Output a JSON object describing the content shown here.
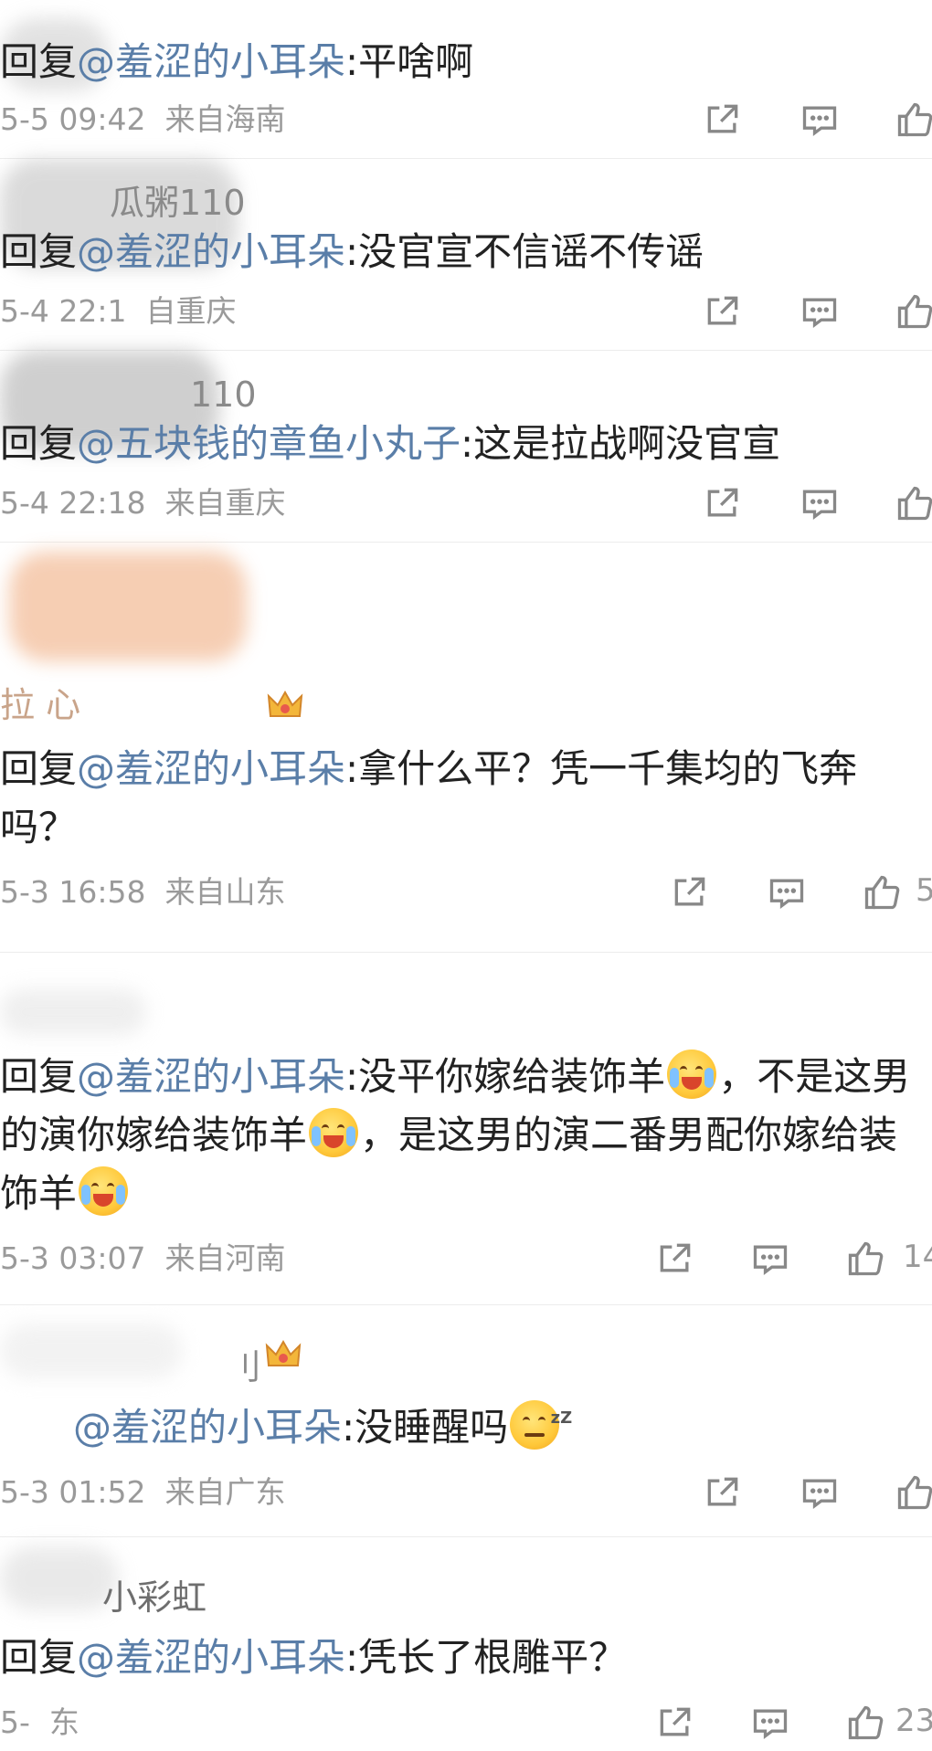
{
  "comments": [
    {
      "username": "",
      "reply_prefix": "回复",
      "mention": "@羞涩的小耳朵",
      "text": ":平啥啊",
      "time": "5-5 09:42",
      "location": "来自海南",
      "likes": ""
    },
    {
      "username": "瓜粥110",
      "reply_prefix": "回复",
      "mention": "@羞涩的小耳朵",
      "text": ":没官宣不信谣不传谣",
      "time": "5-4 22:1",
      "location": "自重庆",
      "likes": ""
    },
    {
      "username": "110",
      "reply_prefix": "回复",
      "mention": "@五块钱的章鱼小丸子",
      "text": ":这是拉战啊没官宣",
      "time": "5-4 22:18",
      "location": "来自重庆",
      "likes": ""
    },
    {
      "username": "拉 心",
      "reply_prefix": "回复",
      "mention": "@羞涩的小耳朵",
      "text": ":拿什么平？凭一千集均的飞奔吗？",
      "time": "5-3 16:58",
      "location": "来自山东",
      "likes": "5"
    },
    {
      "username": "",
      "reply_prefix": "回复",
      "mention": "@羞涩的小耳朵",
      "text_parts": [
        ":没平你嫁给装饰羊",
        "，不是这男的演你嫁给装饰羊",
        "，是这男的演二番男配你嫁给装饰羊"
      ],
      "time": "5-3 03:07",
      "location": "来自河南",
      "likes": "14"
    },
    {
      "username": "刂",
      "reply_prefix": "",
      "mention": "@羞涩的小耳朵",
      "text": ":没睡醒吗",
      "time": "5-3 01:52",
      "location": "来自广东",
      "likes": ""
    },
    {
      "username": "小彩虹",
      "reply_prefix": "回复",
      "mention": "@羞涩的小耳朵",
      "text": ":凭长了根雕平？",
      "time": "5-",
      "location": "东",
      "likes": "23"
    }
  ],
  "icons": {
    "share": "share-icon",
    "comment": "comment-icon",
    "like": "thumbs-up-icon",
    "crown": "crown-icon"
  },
  "colors": {
    "mention": "#5a7ea8",
    "text": "#222222",
    "meta": "#9a9a9a"
  }
}
